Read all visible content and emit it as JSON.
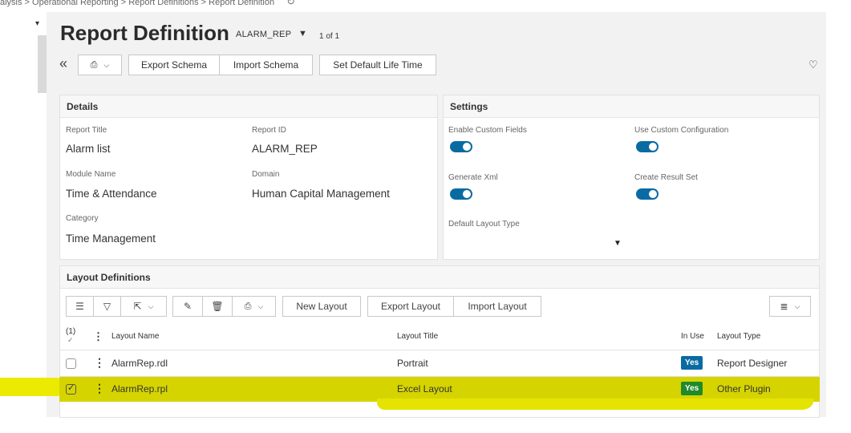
{
  "breadcrumb": {
    "text": "alysis > Operational Reporting > Report Definitions > Report Definition"
  },
  "header": {
    "title": "Report Definition",
    "record_id": "ALARM_REP",
    "record_count": "1 of 1"
  },
  "toolbar": {
    "export_schema": "Export Schema",
    "import_schema": "Import Schema",
    "set_default_life_time": "Set Default Life Time"
  },
  "details": {
    "heading": "Details",
    "report_title_label": "Report Title",
    "report_title_value": "Alarm list",
    "report_id_label": "Report ID",
    "report_id_value": "ALARM_REP",
    "module_name_label": "Module Name",
    "module_name_value": "Time & Attendance",
    "domain_label": "Domain",
    "domain_value": "Human Capital Management",
    "category_label": "Category",
    "category_value": "Time Management"
  },
  "settings": {
    "heading": "Settings",
    "enable_custom_fields_label": "Enable Custom Fields",
    "enable_custom_fields_on": true,
    "use_custom_configuration_label": "Use Custom Configuration",
    "use_custom_configuration_on": true,
    "generate_xml_label": "Generate Xml",
    "generate_xml_on": true,
    "create_result_set_label": "Create Result Set",
    "create_result_set_on": true,
    "default_layout_type_label": "Default Layout Type"
  },
  "layouts": {
    "heading": "Layout Definitions",
    "new_layout": "New Layout",
    "export_layout": "Export Layout",
    "import_layout": "Import Layout",
    "selected_count": "(1)",
    "columns": {
      "layout_name": "Layout Name",
      "layout_title": "Layout Title",
      "in_use": "In Use",
      "layout_type": "Layout Type"
    },
    "rows": [
      {
        "layout_name": "AlarmRep.rdl",
        "layout_title": "Portrait",
        "in_use": "Yes",
        "layout_type": "Report Designer",
        "checked": false
      },
      {
        "layout_name": "AlarmRep.rpl",
        "layout_title": "Excel Layout",
        "in_use": "Yes",
        "layout_type": "Other Plugin",
        "checked": true
      }
    ]
  },
  "colors": {
    "toggle_on": "#0a6ba3",
    "badge_blue": "#0a6ba3",
    "badge_green": "#1f8a2a",
    "highlight": "#d6d400"
  },
  "icons": {
    "refresh": "refresh-icon",
    "collapse": "double-chevron-left-icon",
    "favorite": "heart-icon",
    "list_view": "list-icon",
    "filter": "filter-icon",
    "export": "export-icon",
    "edit": "pencil-icon",
    "delete": "trash-icon",
    "actions": "stamp-icon",
    "column_chooser": "menu-lines-icon"
  }
}
